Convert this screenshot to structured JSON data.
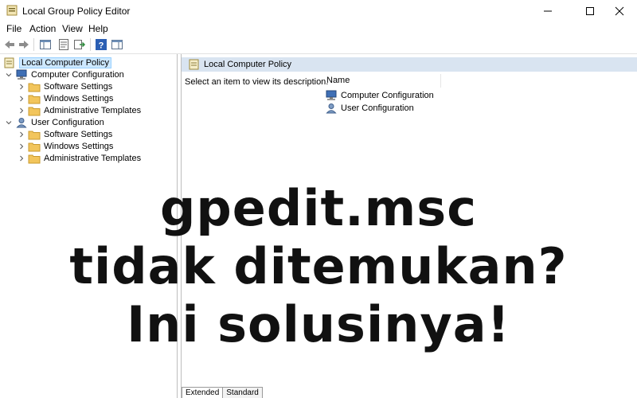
{
  "window": {
    "title": "Local Group Policy Editor"
  },
  "menu": [
    "File",
    "Action",
    "View",
    "Help"
  ],
  "toolbar": {
    "buttons": [
      "back-icon",
      "forward-icon",
      "show-hide-tree-icon",
      "properties-icon",
      "export-list-icon",
      "help-icon",
      "show-hide-action-pane-icon"
    ]
  },
  "tree": {
    "root": "Local Computer Policy",
    "computer": "Computer Configuration",
    "computer_children": [
      "Software Settings",
      "Windows Settings",
      "Administrative Templates"
    ],
    "user": "User Configuration",
    "user_children": [
      "Software Settings",
      "Windows Settings",
      "Administrative Templates"
    ]
  },
  "right_pane": {
    "header": "Local Computer Policy",
    "description": "Select an item to view its description.",
    "column_name": "Name",
    "items": [
      "Computer Configuration",
      "User Configuration"
    ],
    "tabs": [
      "Extended",
      "Standard"
    ]
  },
  "overlay": {
    "lines": [
      "gpedit.msc",
      "tidak ditemukan?",
      "Ini solusinya!"
    ]
  },
  "colors": {
    "selection_bg": "#cde8ff",
    "header_bg": "#d9e4f1",
    "folder": "#f2c55c"
  }
}
